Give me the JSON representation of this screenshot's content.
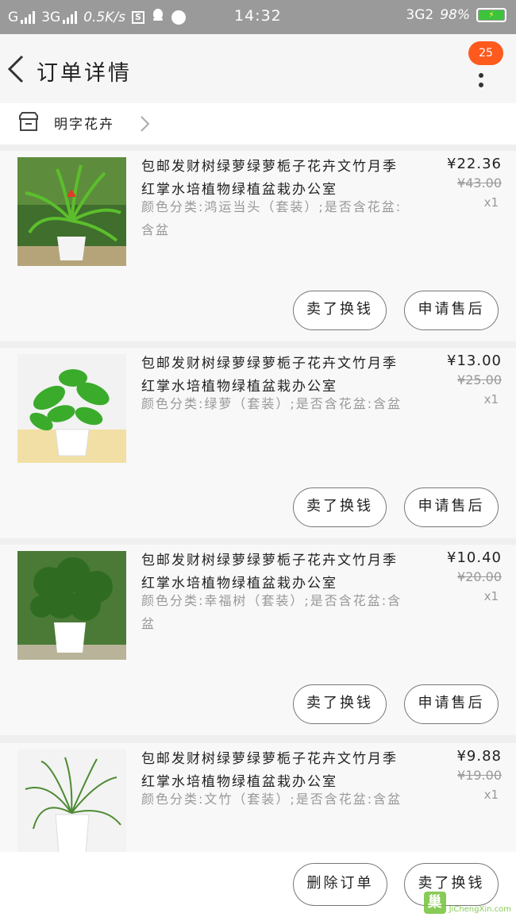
{
  "status_bar": {
    "carrier1": "G",
    "carrier2": "3G",
    "speed": "0.5K/s",
    "time": "14:32",
    "network": "3G2",
    "battery": "98%"
  },
  "header": {
    "title": "订单详情",
    "badge": "25"
  },
  "shop": {
    "name": "明字花卉"
  },
  "products": [
    {
      "title": "包邮发财树绿萝绿萝栀子花卉文竹月季红掌水培植物绿植盆栽办公室",
      "spec": "颜色分类:鸿运当头（套装）;是否含花盆:含盆",
      "price": "¥22.36",
      "original_price": "¥43.00",
      "qty": "x1",
      "btn1": "卖了换钱",
      "btn2": "申请售后"
    },
    {
      "title": "包邮发财树绿萝绿萝栀子花卉文竹月季红掌水培植物绿植盆栽办公室",
      "spec": "颜色分类:绿萝（套装）;是否含花盆:含盆",
      "price": "¥13.00",
      "original_price": "¥25.00",
      "qty": "x1",
      "btn1": "卖了换钱",
      "btn2": "申请售后"
    },
    {
      "title": "包邮发财树绿萝绿萝栀子花卉文竹月季红掌水培植物绿植盆栽办公室",
      "spec": "颜色分类:幸福树（套装）;是否含花盆:含盆",
      "price": "¥10.40",
      "original_price": "¥20.00",
      "qty": "x1",
      "btn1": "卖了换钱",
      "btn2": "申请售后"
    },
    {
      "title": "包邮发财树绿萝绿萝栀子花卉文竹月季红掌水培植物绿植盆栽办公室",
      "spec": "颜色分类:文竹（套装）;是否含花盆:含盆",
      "price": "¥9.88",
      "original_price": "¥19.00",
      "qty": "x1"
    }
  ],
  "footer": {
    "delete_label": "删除订单",
    "sell_label": "卖了换钱"
  },
  "watermark": {
    "logo": "巢",
    "text": "JiChengXin.com"
  },
  "colors": {
    "badge": "#ff5a1e",
    "status_bar": "#9a9a9a"
  }
}
